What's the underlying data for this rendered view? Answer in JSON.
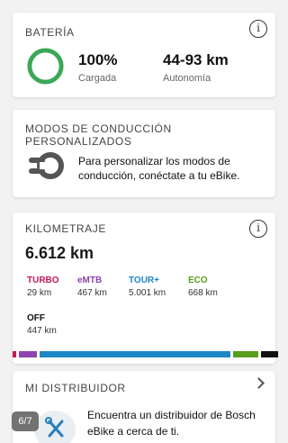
{
  "battery": {
    "title": "BATERÍA",
    "info_glyph": "i",
    "charge_value": "100%",
    "charge_label": "Cargada",
    "range_value": "44-93 km",
    "range_label": "Autonomía",
    "charge_fraction": 1.0,
    "ring_color": "#3aa856"
  },
  "modes": {
    "title": "MODOS DE CONDUCCIÓN PERSONALIZADOS",
    "icon": "custom-ride-mode-icon",
    "message": "Para personalizar los modos de conducción, conéctate a tu eBike."
  },
  "mileage": {
    "title": "KILOMETRAJE",
    "info_glyph": "i",
    "total": "6.612 km",
    "modes": [
      {
        "name": "TURBO",
        "value": "29 km",
        "color": "#c2185b",
        "km": 29
      },
      {
        "name": "eMTB",
        "value": "467 km",
        "color": "#8e44ad",
        "km": 467
      },
      {
        "name": "TOUR+",
        "value": "5.001 km",
        "color": "#1e88c7",
        "km": 5001
      },
      {
        "name": "ECO",
        "value": "668 km",
        "color": "#5a9e1c",
        "km": 668
      },
      {
        "name": "OFF",
        "value": "447 km",
        "color": "#111111",
        "km": 447
      }
    ]
  },
  "dealer": {
    "title": "MI DISTRIBUIDOR",
    "message": "Encuentra un distribuidor de Bosch eBike a cerca de ti."
  },
  "pager": {
    "label": "6/7"
  }
}
